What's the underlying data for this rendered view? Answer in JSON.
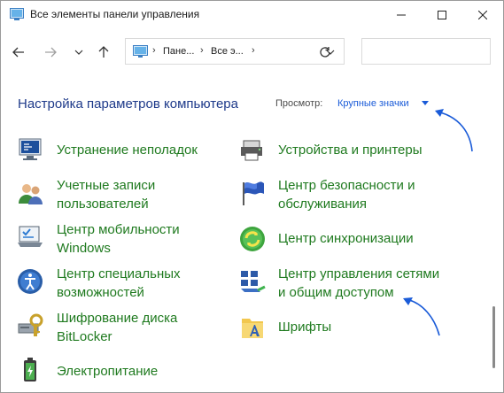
{
  "window": {
    "title": "Все элементы панели управления"
  },
  "address": {
    "crumbs": [
      "Пане...",
      "Все э..."
    ]
  },
  "search": {
    "placeholder": ""
  },
  "header": {
    "heading": "Настройка параметров компьютера",
    "view_label": "Просмотр:",
    "view_value": "Крупные значки"
  },
  "items_left": [
    {
      "label": "Устранение неполадок",
      "icon": "troubleshooting-icon"
    },
    {
      "label": "Учетные записи\nпользователей",
      "icon": "user-accounts-icon"
    },
    {
      "label": "Центр мобильности\nWindows",
      "icon": "mobility-center-icon"
    },
    {
      "label": "Центр специальных\nвозможностей",
      "icon": "ease-of-access-icon"
    },
    {
      "label": "Шифрование диска\nBitLocker",
      "icon": "bitlocker-icon"
    },
    {
      "label": "Электропитание",
      "icon": "power-options-icon"
    }
  ],
  "items_right": [
    {
      "label": "Устройства и принтеры",
      "icon": "devices-printers-icon"
    },
    {
      "label": "Центр безопасности и\nобслуживания",
      "icon": "security-flag-icon"
    },
    {
      "label": "Центр синхронизации",
      "icon": "sync-center-icon"
    },
    {
      "label": "Центр управления сетями\nи общим доступом",
      "icon": "network-center-icon"
    },
    {
      "label": "Шрифты",
      "icon": "fonts-folder-icon"
    }
  ],
  "colors": {
    "link_green": "#1f7a1f",
    "heading_blue": "#1e3a8a",
    "accent_blue": "#1a5bd8"
  }
}
